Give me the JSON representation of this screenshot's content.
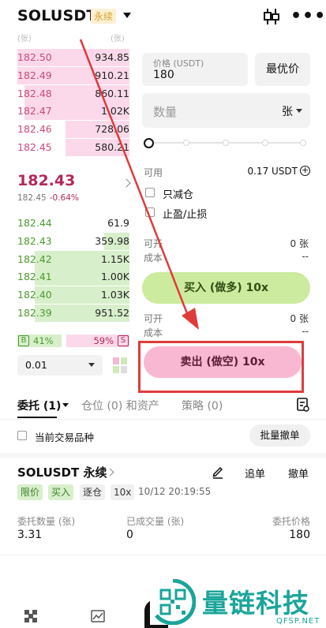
{
  "header": {
    "symbol": "SOLUSDT",
    "badge": "永续",
    "icons": {
      "dropdown": "caret-down-icon",
      "chart": "candle-chart-icon",
      "more": "more-dots-icon"
    },
    "more_glyph": "•••"
  },
  "subhead": {
    "left": "(张)",
    "right": "(张)"
  },
  "orderbook": {
    "asks": [
      {
        "price": "182.50",
        "qty": "934.85",
        "depth": 1.0
      },
      {
        "price": "182.49",
        "qty": "910.21",
        "depth": 1.0
      },
      {
        "price": "182.48",
        "qty": "860.11",
        "depth": 0.94
      },
      {
        "price": "182.47",
        "qty": "1.02K",
        "depth": 0.94
      },
      {
        "price": "182.46",
        "qty": "728.06",
        "depth": 0.57
      },
      {
        "price": "182.45",
        "qty": "580.21",
        "depth": 0.57
      }
    ],
    "last_price": "182.43",
    "mark_price": "182.45",
    "change": "-0.64%",
    "bids": [
      {
        "price": "182.44",
        "qty": "61.9",
        "depth": 0.0
      },
      {
        "price": "182.43",
        "qty": "359.98",
        "depth": 0.27
      },
      {
        "price": "182.42",
        "qty": "1.15K",
        "depth": 1.0
      },
      {
        "price": "182.41",
        "qty": "1.00K",
        "depth": 1.0
      },
      {
        "price": "182.40",
        "qty": "1.03K",
        "depth": 1.0
      },
      {
        "price": "182.39",
        "qty": "951.52",
        "depth": 1.0
      }
    ],
    "buy_badge": "B",
    "buy_ratio": "41%",
    "sell_ratio": "59%",
    "sell_badge": "S",
    "precision": "0.01"
  },
  "form": {
    "price_label": "价格 (USDT)",
    "price_value": "180",
    "best_price_button": "最优价",
    "qty_placeholder": "数量",
    "qty_unit": "张",
    "available_label": "可用",
    "available_value": "0.17 USDT",
    "reduce_only": "只减仓",
    "tp_sl": "止盈/止损",
    "can_open_long_label": "可开",
    "can_open_long_value": "0 张",
    "cost_long_label": "成本",
    "cost_long_value": "--",
    "buy_button": "买入 (做多) 10x",
    "can_open_short_label": "可开",
    "can_open_short_value": "0 张",
    "cost_short_label": "成本",
    "cost_short_value": "--",
    "sell_button": "卖出 (做空) 10x",
    "highlight_color": "#e03b3b"
  },
  "tabs": {
    "orders": "委托 (1)",
    "positions": "仓位 (0) 和资产",
    "strategies": "策略 (0)"
  },
  "filter": {
    "current_symbol": "当前交易品种",
    "cancel_all": "批量撤单"
  },
  "order": {
    "title": "SOLUSDT 永续",
    "chase": "追单",
    "cancel": "撤单",
    "tags": [
      "限价",
      "买入",
      "逐仓",
      "10x"
    ],
    "time": "10/12 20:19:55",
    "qty_label": "委托数量 (张)",
    "qty_value": "3.31",
    "filled_label": "已成交量 (张)",
    "filled_value": "0",
    "price_label": "委托价格",
    "price_value": "180"
  },
  "watermark": {
    "text": "量链科技",
    "site": "QFSP.NET"
  }
}
